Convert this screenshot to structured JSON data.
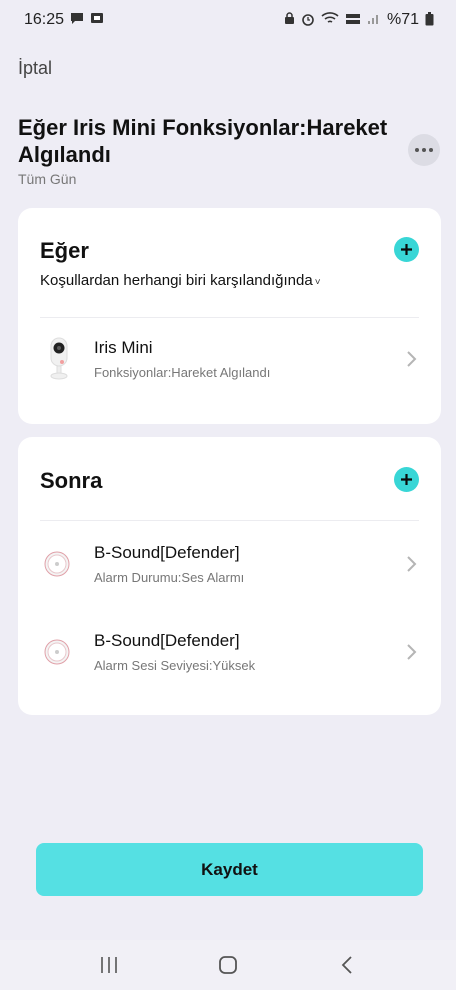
{
  "status_bar": {
    "time": "16:25",
    "battery": "%71"
  },
  "header": {
    "cancel_label": "İptal",
    "title": "Eğer Iris Mini Fonksiyonlar:Hareket Algılandı",
    "subtitle": "Tüm Gün"
  },
  "if_card": {
    "title": "Eğer",
    "condition_mode": "Koşullardan herhangi biri karşılandığında",
    "items": [
      {
        "name": "Iris Mini",
        "desc": "Fonksiyonlar:Hareket Algılandı"
      }
    ]
  },
  "then_card": {
    "title": "Sonra",
    "items": [
      {
        "name": "B-Sound[Defender]",
        "desc": "Alarm Durumu:Ses Alarmı"
      },
      {
        "name": "B-Sound[Defender]",
        "desc": "Alarm Sesi Seviyesi:Yüksek"
      }
    ]
  },
  "save_label": "Kaydet",
  "colors": {
    "accent": "#38d6d6",
    "save_button": "#55e0e3",
    "background": "#eeedf5"
  }
}
